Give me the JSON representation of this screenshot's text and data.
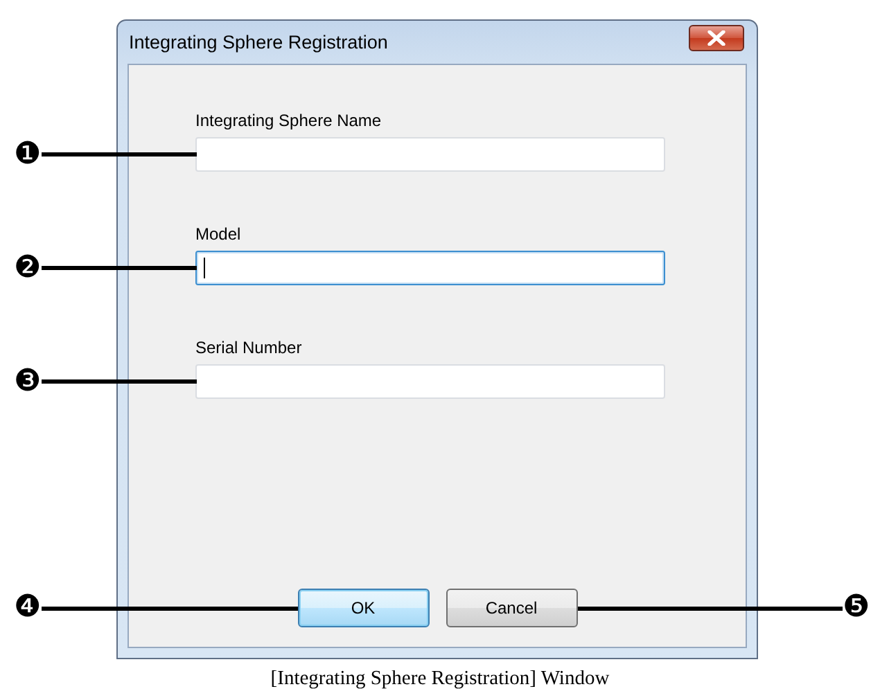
{
  "window": {
    "title": "Integrating Sphere Registration"
  },
  "fields": [
    {
      "label": "Integrating Sphere Name",
      "focused": false,
      "callout": "❶"
    },
    {
      "label": "Model",
      "focused": true,
      "callout": "❷"
    },
    {
      "label": "Serial Number",
      "focused": false,
      "callout": "❸"
    }
  ],
  "buttons": [
    {
      "label": "OK",
      "default": true,
      "callout": "❹",
      "callout_on_right": false
    },
    {
      "label": "Cancel",
      "default": false,
      "callout": "❺",
      "callout_on_right": true
    }
  ],
  "caption": "[Integrating Sphere Registration] Window"
}
